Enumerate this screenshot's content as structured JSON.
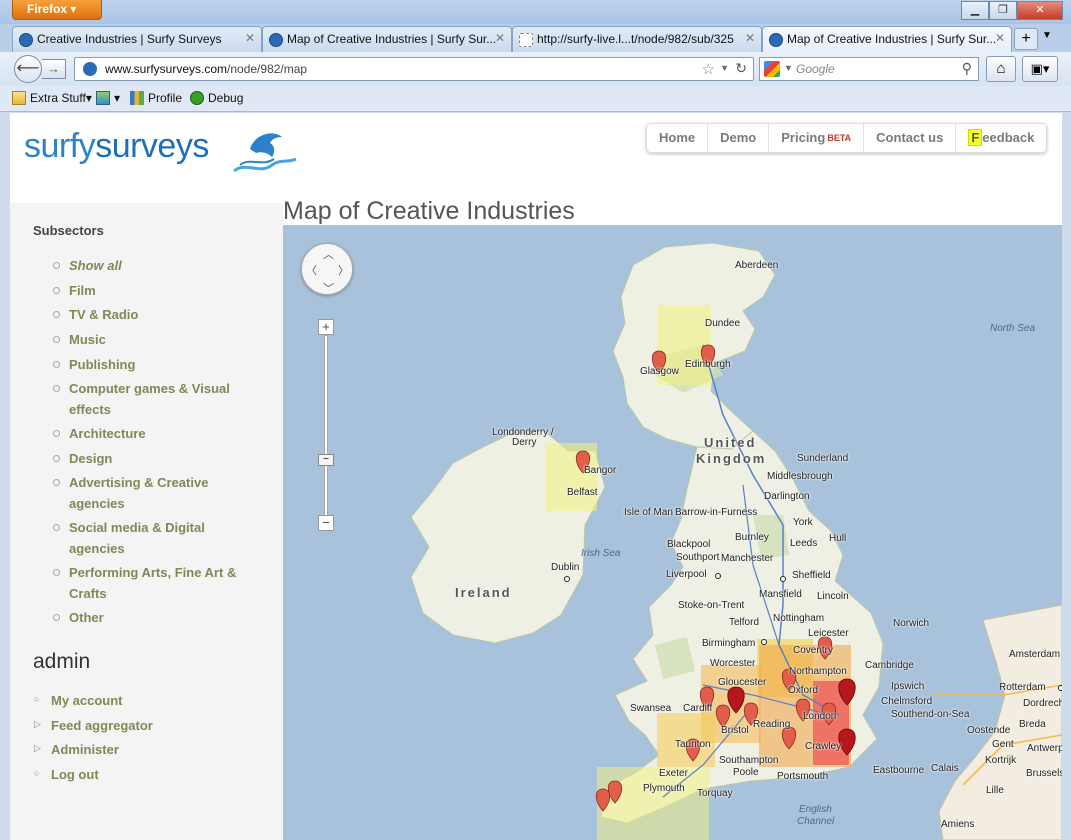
{
  "browser": {
    "app_button": "Firefox",
    "tabs": [
      {
        "title": "Creative Industries | Surfy Surveys"
      },
      {
        "title": "Map of Creative Industries | Surfy Sur..."
      },
      {
        "title": "http://surfy-live.l...t/node/982/sub/325"
      },
      {
        "title": "Map of Creative Industries | Surfy Sur..."
      }
    ],
    "url_domain": "www.surfysurveys.com",
    "url_path": "/node/982/map",
    "search_placeholder": "Google",
    "bookmarks": [
      {
        "label": "Extra Stuff"
      },
      {
        "label": "Profile"
      },
      {
        "label": "Debug"
      }
    ]
  },
  "site": {
    "logo_part1": "surfy",
    "logo_part2": "surveys",
    "nav": {
      "home": "Home",
      "demo": "Demo",
      "pricing": "Pricing",
      "beta": "BETA",
      "contact": "Contact us",
      "feedback_letter": "F",
      "feedback_rest": "eedback"
    }
  },
  "page_title": "Map of Creative Industries",
  "sidebar": {
    "heading": "Subsectors",
    "items": [
      {
        "label": "Show all"
      },
      {
        "label": "Film"
      },
      {
        "label": "TV & Radio"
      },
      {
        "label": "Music"
      },
      {
        "label": "Publishing"
      },
      {
        "label": "Computer games & Visual effects"
      },
      {
        "label": "Architecture"
      },
      {
        "label": "Design"
      },
      {
        "label": "Advertising & Creative agencies"
      },
      {
        "label": "Social media & Digital agencies"
      },
      {
        "label": "Performing Arts, Fine Art & Crafts"
      },
      {
        "label": "Other"
      }
    ],
    "admin_heading": "admin",
    "admin_items": [
      {
        "label": "My account"
      },
      {
        "label": "Feed aggregator"
      },
      {
        "label": "Administer"
      },
      {
        "label": "Log out"
      }
    ]
  },
  "map": {
    "region_labels": [
      "United",
      "Kingdom",
      "Ireland"
    ],
    "sea_labels": [
      "North Sea",
      "Irish Sea",
      "English",
      "Channel"
    ],
    "cities": [
      "Aberdeen",
      "Dundee",
      "Glasgow",
      "Edinburgh",
      "Londonderry /",
      "Derry",
      "Bangor",
      "Belfast",
      "Sunderland",
      "Middlesbrough",
      "Darlington",
      "Isle of Man",
      "Barrow-in-Furness",
      "York",
      "Blackpool",
      "Burnley",
      "Leeds",
      "Hull",
      "Southport",
      "Manchester",
      "Liverpool",
      "Sheffield",
      "Dublin",
      "Mansfield",
      "Lincoln",
      "Stoke-on-Trent",
      "Nottingham",
      "Telford",
      "Norwich",
      "Birmingham",
      "Leicester",
      "Coventry",
      "Worcester",
      "Northampton",
      "Cambridge",
      "Gloucester",
      "Oxford",
      "Ipswich",
      "Swansea",
      "Cardiff",
      "London",
      "Chelmsford",
      "Southend-on-Sea",
      "Bristol",
      "Reading",
      "Taunton",
      "Crawley",
      "Southampton",
      "Portsmouth",
      "Exeter",
      "Poole",
      "Torquay",
      "Plymouth",
      "Eastbourne",
      "Amsterdam",
      "Rotterdam",
      "Antwerp",
      "Brussels",
      "Oostende",
      "Gent",
      "Kortrijk",
      "Lille",
      "Calais",
      "Amiens",
      "Dordrecht",
      "Breda"
    ]
  },
  "colors": {
    "accent": "#2c82c9",
    "link": "#7d8a58",
    "beta": "#c0392b",
    "water": "#a9c2dc",
    "land": "#eef0e4"
  }
}
